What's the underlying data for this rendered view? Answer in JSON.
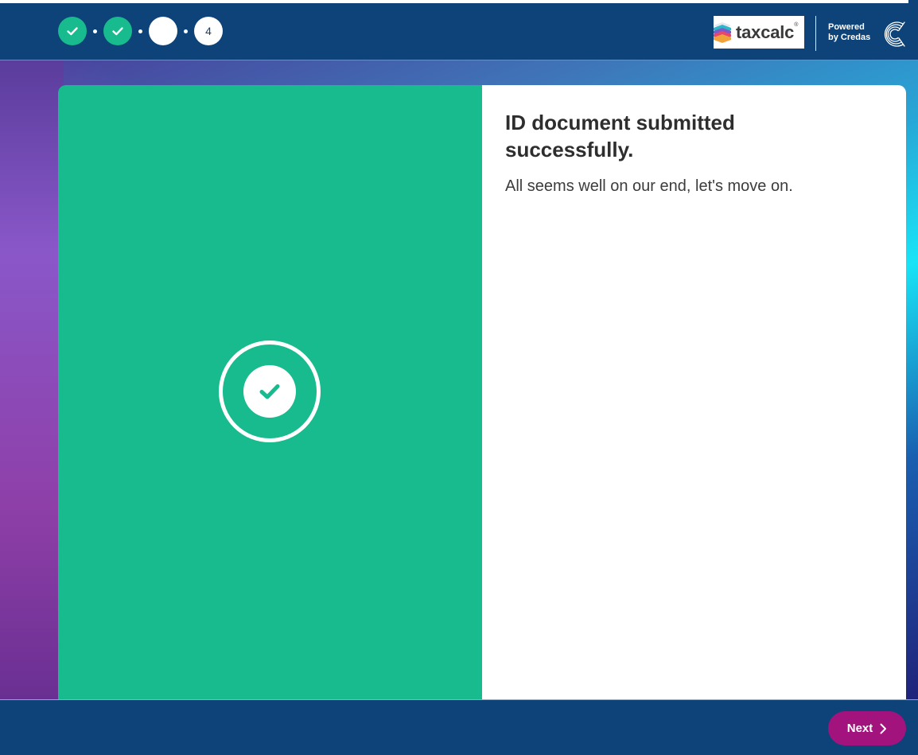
{
  "progress": {
    "steps": [
      {
        "state": "done",
        "icon": "check-icon"
      },
      {
        "state": "done",
        "icon": "check-icon"
      },
      {
        "state": "current",
        "label": ""
      },
      {
        "state": "future",
        "label": "4"
      }
    ]
  },
  "header": {
    "brand_name": "taxcalc",
    "brand_reg": "®",
    "powered_line1": "Powered",
    "powered_line2": "by Credas"
  },
  "main": {
    "title": "ID document submitted successfully.",
    "subtitle": "All seems well on our end, let's move on.",
    "status_icon": "check-circle-icon"
  },
  "footer": {
    "next_label": "Next",
    "next_icon": "chevron-right-icon"
  },
  "colors": {
    "header_bg": "#0d4379",
    "success_green": "#17bb8e",
    "next_button": "#a3137d"
  }
}
